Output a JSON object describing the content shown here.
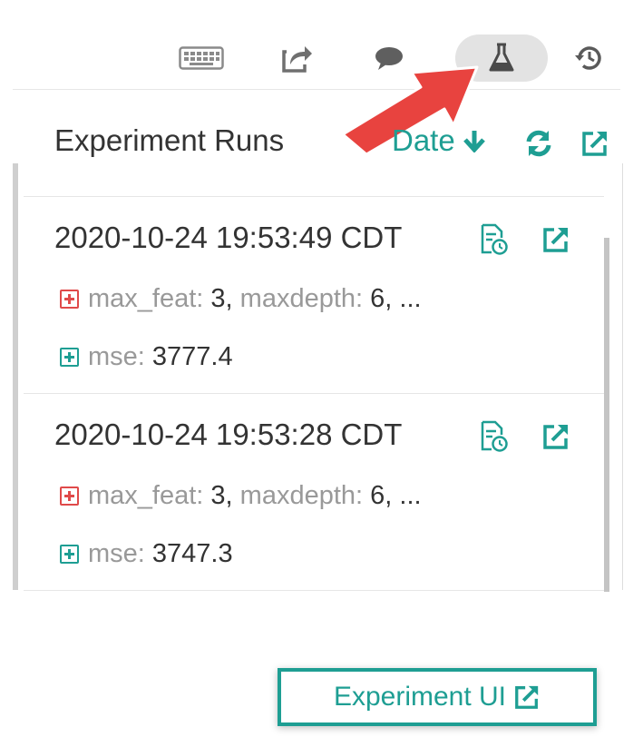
{
  "toolbar": {
    "icons": [
      "keyboard-icon",
      "share-icon",
      "comment-icon",
      "flask-icon",
      "history-icon"
    ],
    "active": "flask-icon"
  },
  "panel": {
    "title": "Experiment Runs",
    "sort_label": "Date"
  },
  "runs": [
    {
      "timestamp": "2020-10-24 19:53:49 CDT",
      "params": {
        "k1": "max_feat:",
        "v1": "3,",
        "k2": "maxdepth:",
        "v2": "6, ..."
      },
      "metrics": {
        "k1": "mse:",
        "v1": "3777.4"
      }
    },
    {
      "timestamp": "2020-10-24 19:53:28 CDT",
      "params": {
        "k1": "max_feat:",
        "v1": "3,",
        "k2": "maxdepth:",
        "v2": "6, ..."
      },
      "metrics": {
        "k1": "mse:",
        "v1": "3747.3"
      }
    }
  ],
  "footer": {
    "experiment_ui_label": "Experiment UI"
  },
  "colors": {
    "accent": "#1e9e93",
    "param_expander": "#e04a4a",
    "arrow": "#e8433f",
    "text": "#333333",
    "muted": "#999999"
  }
}
